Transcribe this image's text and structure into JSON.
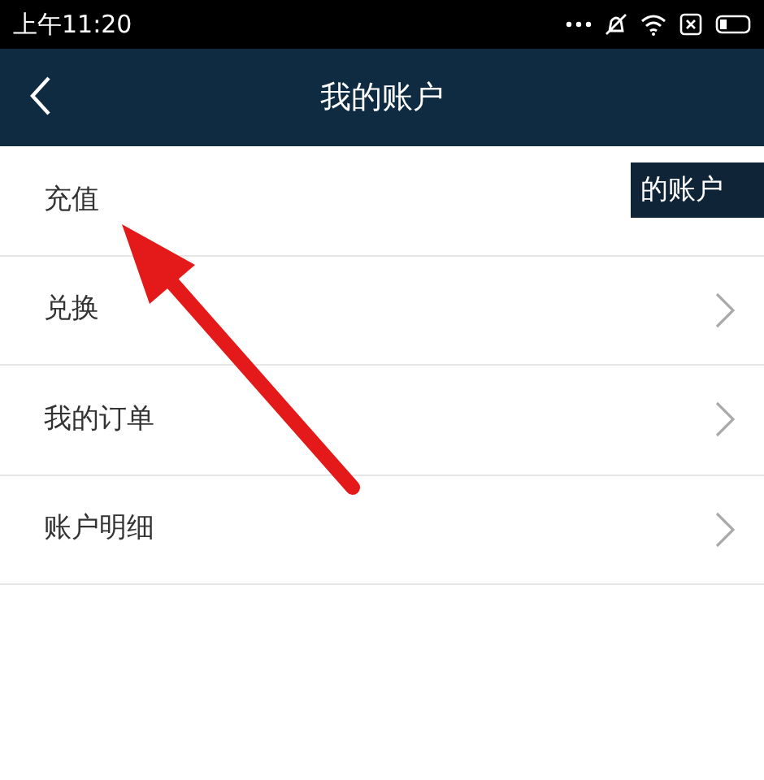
{
  "status_bar": {
    "time": "上午11:20"
  },
  "header": {
    "title": "我的账户"
  },
  "overlay_patch": {
    "text": "的账户"
  },
  "menu_items": [
    {
      "label": "充值",
      "has_chevron": false
    },
    {
      "label": "兑换",
      "has_chevron": true
    },
    {
      "label": "我的订单",
      "has_chevron": true
    },
    {
      "label": "账户明细",
      "has_chevron": true
    }
  ]
}
